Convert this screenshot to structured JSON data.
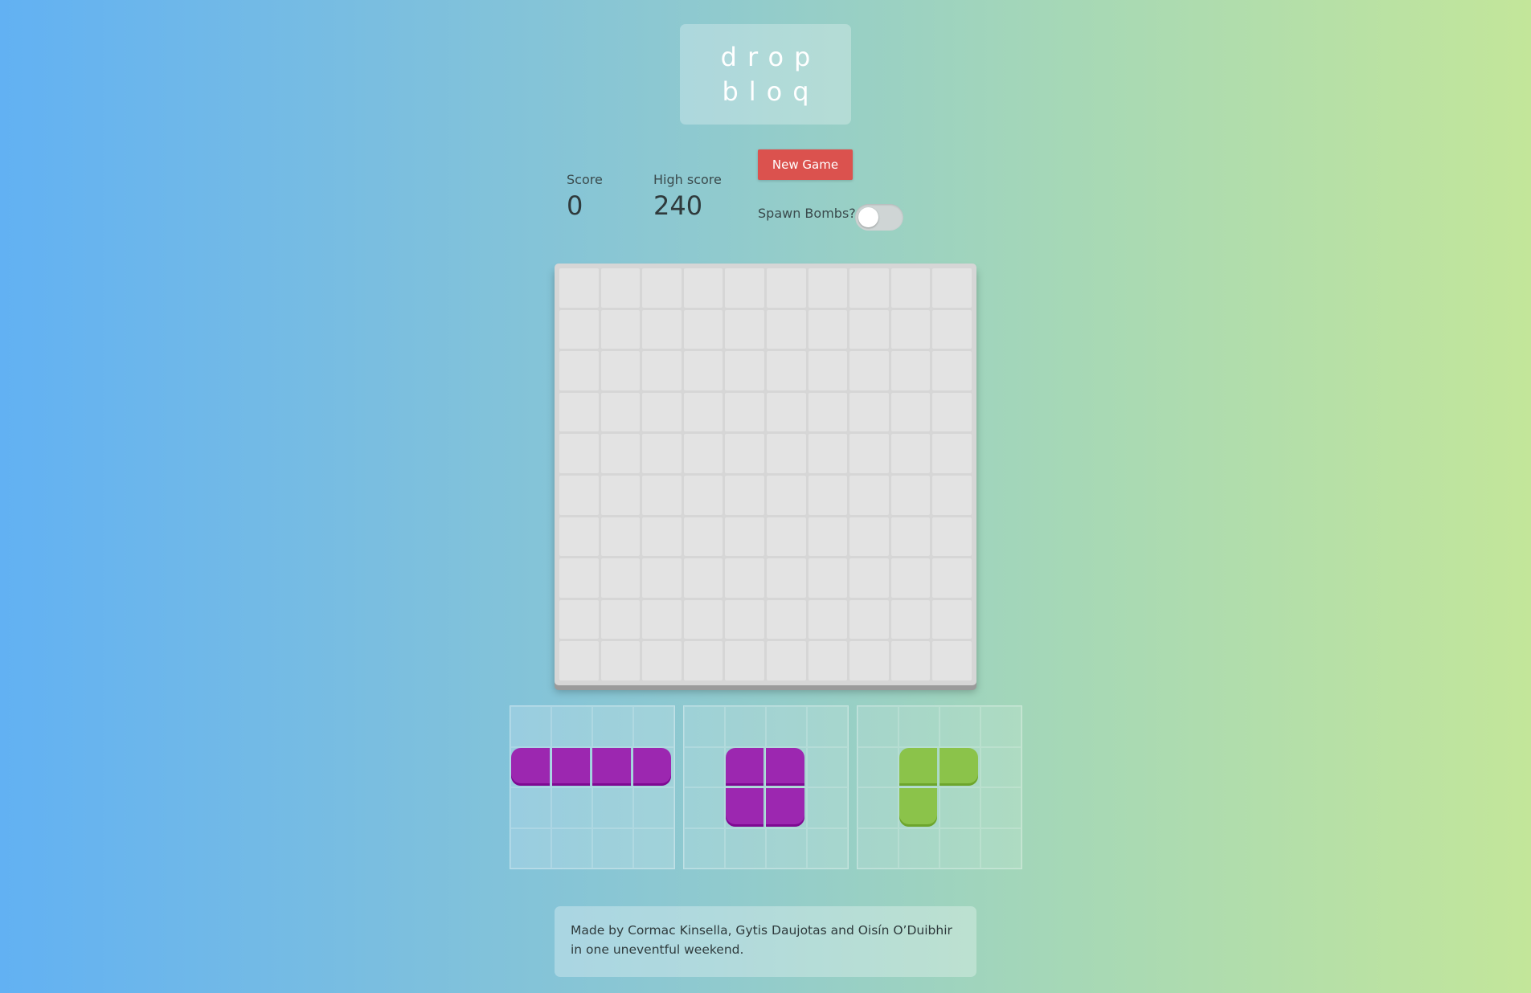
{
  "logo": {
    "line1": "drop",
    "line2": "bloq"
  },
  "score": {
    "label": "Score",
    "value": "0"
  },
  "high_score": {
    "label": "High score",
    "value": "240"
  },
  "new_game_label": "New Game",
  "spawn_bombs": {
    "label": "Spawn Bombs?",
    "enabled": false
  },
  "board": {
    "rows": 10,
    "cols": 10,
    "filled_cells": []
  },
  "pieces": [
    {
      "color": "#9c27b0",
      "cells": [
        [
          1,
          0
        ],
        [
          1,
          1
        ],
        [
          1,
          2
        ],
        [
          1,
          3
        ]
      ]
    },
    {
      "color": "#9c27b0",
      "cells": [
        [
          1,
          1
        ],
        [
          1,
          2
        ],
        [
          2,
          1
        ],
        [
          2,
          2
        ]
      ]
    },
    {
      "color": "#8bc34a",
      "cells": [
        [
          1,
          1
        ],
        [
          1,
          2
        ],
        [
          2,
          1
        ]
      ]
    }
  ],
  "footer": "Made by Cormac Kinsella, Gytis Daujotas and Oisín O’Duibhir in one uneventful weekend."
}
